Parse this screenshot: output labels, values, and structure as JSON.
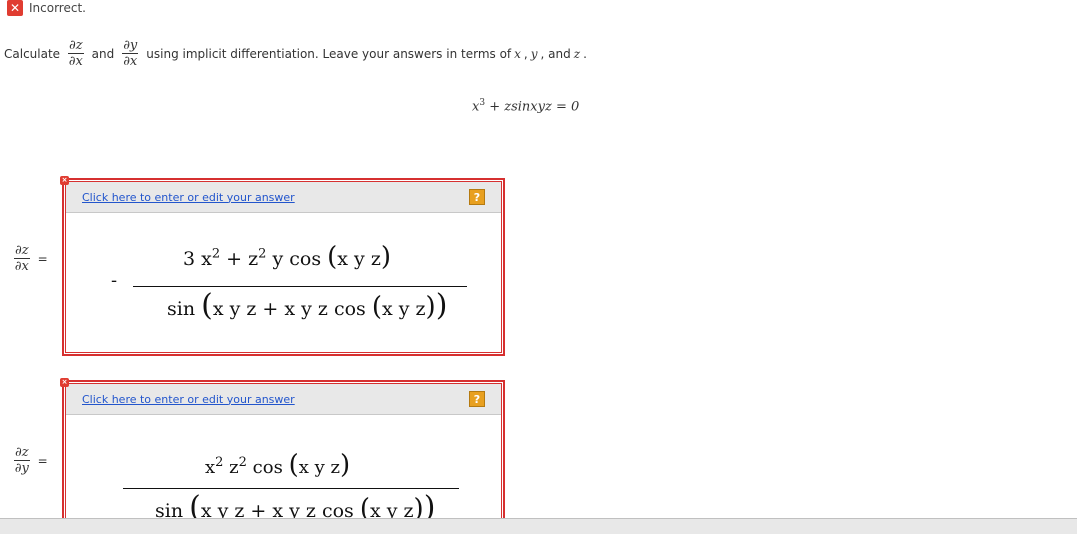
{
  "status": {
    "icon": "x-icon",
    "text": "Incorrect."
  },
  "question": {
    "calculate": "Calculate",
    "d1_num": "∂z",
    "d1_den": "∂x",
    "and": "and",
    "d2_num": "∂y",
    "d2_den": "∂x",
    "instruction": "using implicit differentiation. Leave your answers in terms of",
    "var_x": "x",
    "comma1": ",",
    "var_y": "y",
    "comma2": ", and",
    "var_z": "z",
    "period": "."
  },
  "equation": {
    "base": "x",
    "exp": "3",
    "rest": " + zsinxyz = 0"
  },
  "answer1": {
    "lhs_num": "∂z",
    "lhs_den": "∂x",
    "eq": "=",
    "link": "Click here to enter or edit your answer",
    "help": "?",
    "sign": "-",
    "num": {
      "t1": "3 x",
      "e1": "2",
      "plus": "+ z",
      "e2": "2",
      "t2": "y cos",
      "arg": "x y z"
    },
    "den": {
      "t1": "sin",
      "a1": "x y z + x y z cos",
      "a2": "x y z"
    }
  },
  "answer2": {
    "lhs_num": "∂z",
    "lhs_den": "∂y",
    "eq": "=",
    "link": "Click here to enter or edit your answer",
    "help": "?",
    "num": {
      "t1": "x",
      "e1": "2",
      "t2": "z",
      "e2": "2",
      "t3": "cos",
      "arg": "x y z"
    },
    "den": {
      "t1": "sin",
      "a1": "x y z + x y z cos",
      "a2": "x y z"
    }
  }
}
